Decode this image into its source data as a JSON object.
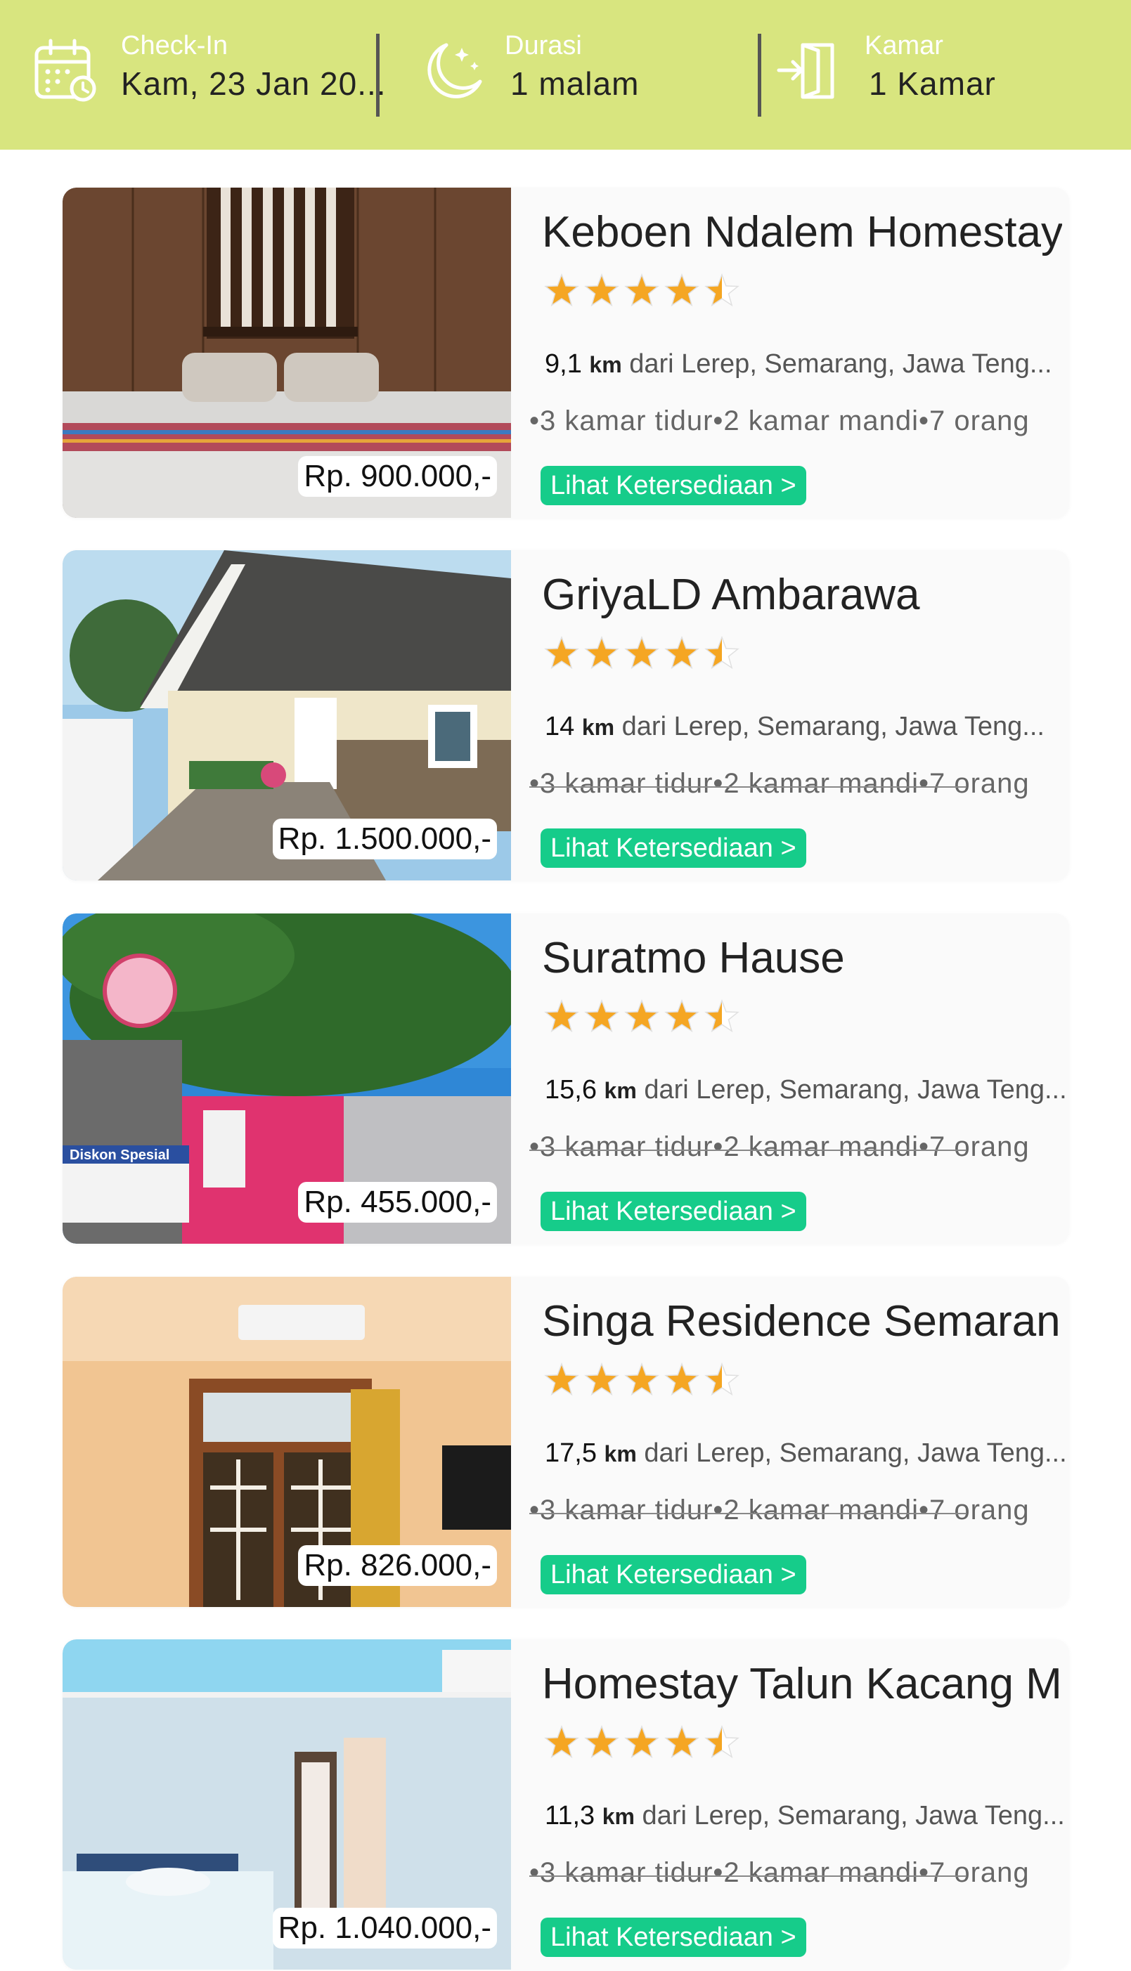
{
  "header": {
    "checkin": {
      "label": "Check-In",
      "value": "Kam, 23 Jan 20..."
    },
    "duration": {
      "label": "Durasi",
      "value": "1 malam"
    },
    "rooms": {
      "label": "Kamar",
      "value": "1 Kamar"
    }
  },
  "listings": [
    {
      "name": "Keboen Ndalem Homestay",
      "rating": 4.5,
      "distance_value": "9,1",
      "distance_unit": "km",
      "distance_text": "dari Lerep, Semarang, Jawa Teng...",
      "rooms_text": "•3 kamar tidur•2 kamar mandi•7 orang",
      "price": "Rp. 900.000,-",
      "button": "Lihat Ketersediaan >"
    },
    {
      "name": "GriyaLD Ambarawa",
      "rating": 4.5,
      "distance_value": "14",
      "distance_unit": "km",
      "distance_text": "dari Lerep, Semarang, Jawa Teng...",
      "rooms_text": "•3 kamar tidur•2 kamar mandi•7 orang",
      "price": "Rp. 1.500.000,-",
      "button": "Lihat Ketersediaan >"
    },
    {
      "name": "Suratmo Hause",
      "rating": 4.5,
      "distance_value": "15,6",
      "distance_unit": "km",
      "distance_text": "dari Lerep, Semarang, Jawa Teng...",
      "rooms_text": "•3 kamar tidur•2 kamar mandi•7 orang",
      "price": "Rp. 455.000,-",
      "button": "Lihat Ketersediaan >"
    },
    {
      "name": "Singa Residence Semarang",
      "rating": 4.5,
      "distance_value": "17,5",
      "distance_unit": "km",
      "distance_text": "dari Lerep, Semarang, Jawa Teng...",
      "rooms_text": "•3 kamar tidur•2 kamar mandi•7 orang",
      "price": "Rp. 826.000,-",
      "button": "Lihat Ketersediaan >"
    },
    {
      "name": "Homestay Talun Kacang M..",
      "rating": 4.5,
      "distance_value": "11,3",
      "distance_unit": "km",
      "distance_text": "dari Lerep, Semarang, Jawa Teng...",
      "rooms_text": "•3 kamar tidur•2 kamar mandi•7 orang",
      "price": "Rp. 1.040.000,-",
      "button": "Lihat Ketersediaan >"
    }
  ],
  "colors": {
    "header_bg": "#d8e57f",
    "button_bg": "#16cc8a",
    "star": "#f5a623"
  }
}
